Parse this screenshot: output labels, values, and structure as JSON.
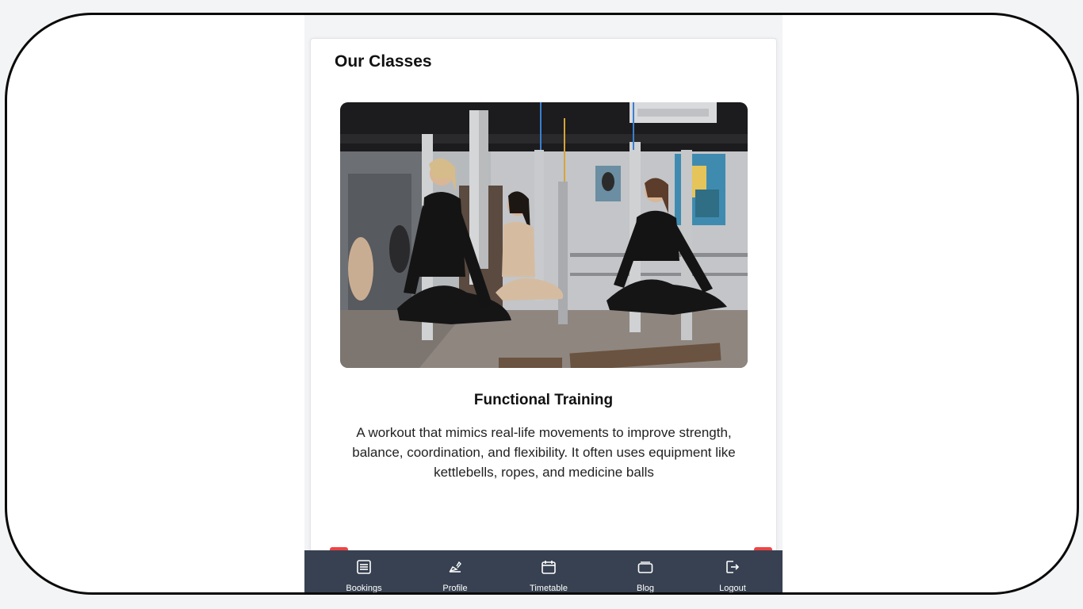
{
  "page": {
    "title": "Our Classes"
  },
  "carousel": {
    "current_class": {
      "name": "Functional Training",
      "description": "A workout that mimics real-life movements to improve strength, balance, coordination, and flexibility. It often uses equipment like kettlebells, ropes, and medicine balls",
      "image_subject": "aerial yoga class"
    },
    "prev_label": "‹",
    "next_label": "›"
  },
  "bottom_nav": {
    "items": [
      {
        "label": "Bookings",
        "icon": "list-icon"
      },
      {
        "label": "Profile",
        "icon": "edit-icon"
      },
      {
        "label": "Timetable",
        "icon": "calendar-icon"
      },
      {
        "label": "Blog",
        "icon": "card-icon"
      },
      {
        "label": "Logout",
        "icon": "logout-icon"
      }
    ]
  },
  "colors": {
    "accent": "#ef4444",
    "nav_bg": "#374151",
    "page_bg": "#f3f4f6"
  }
}
